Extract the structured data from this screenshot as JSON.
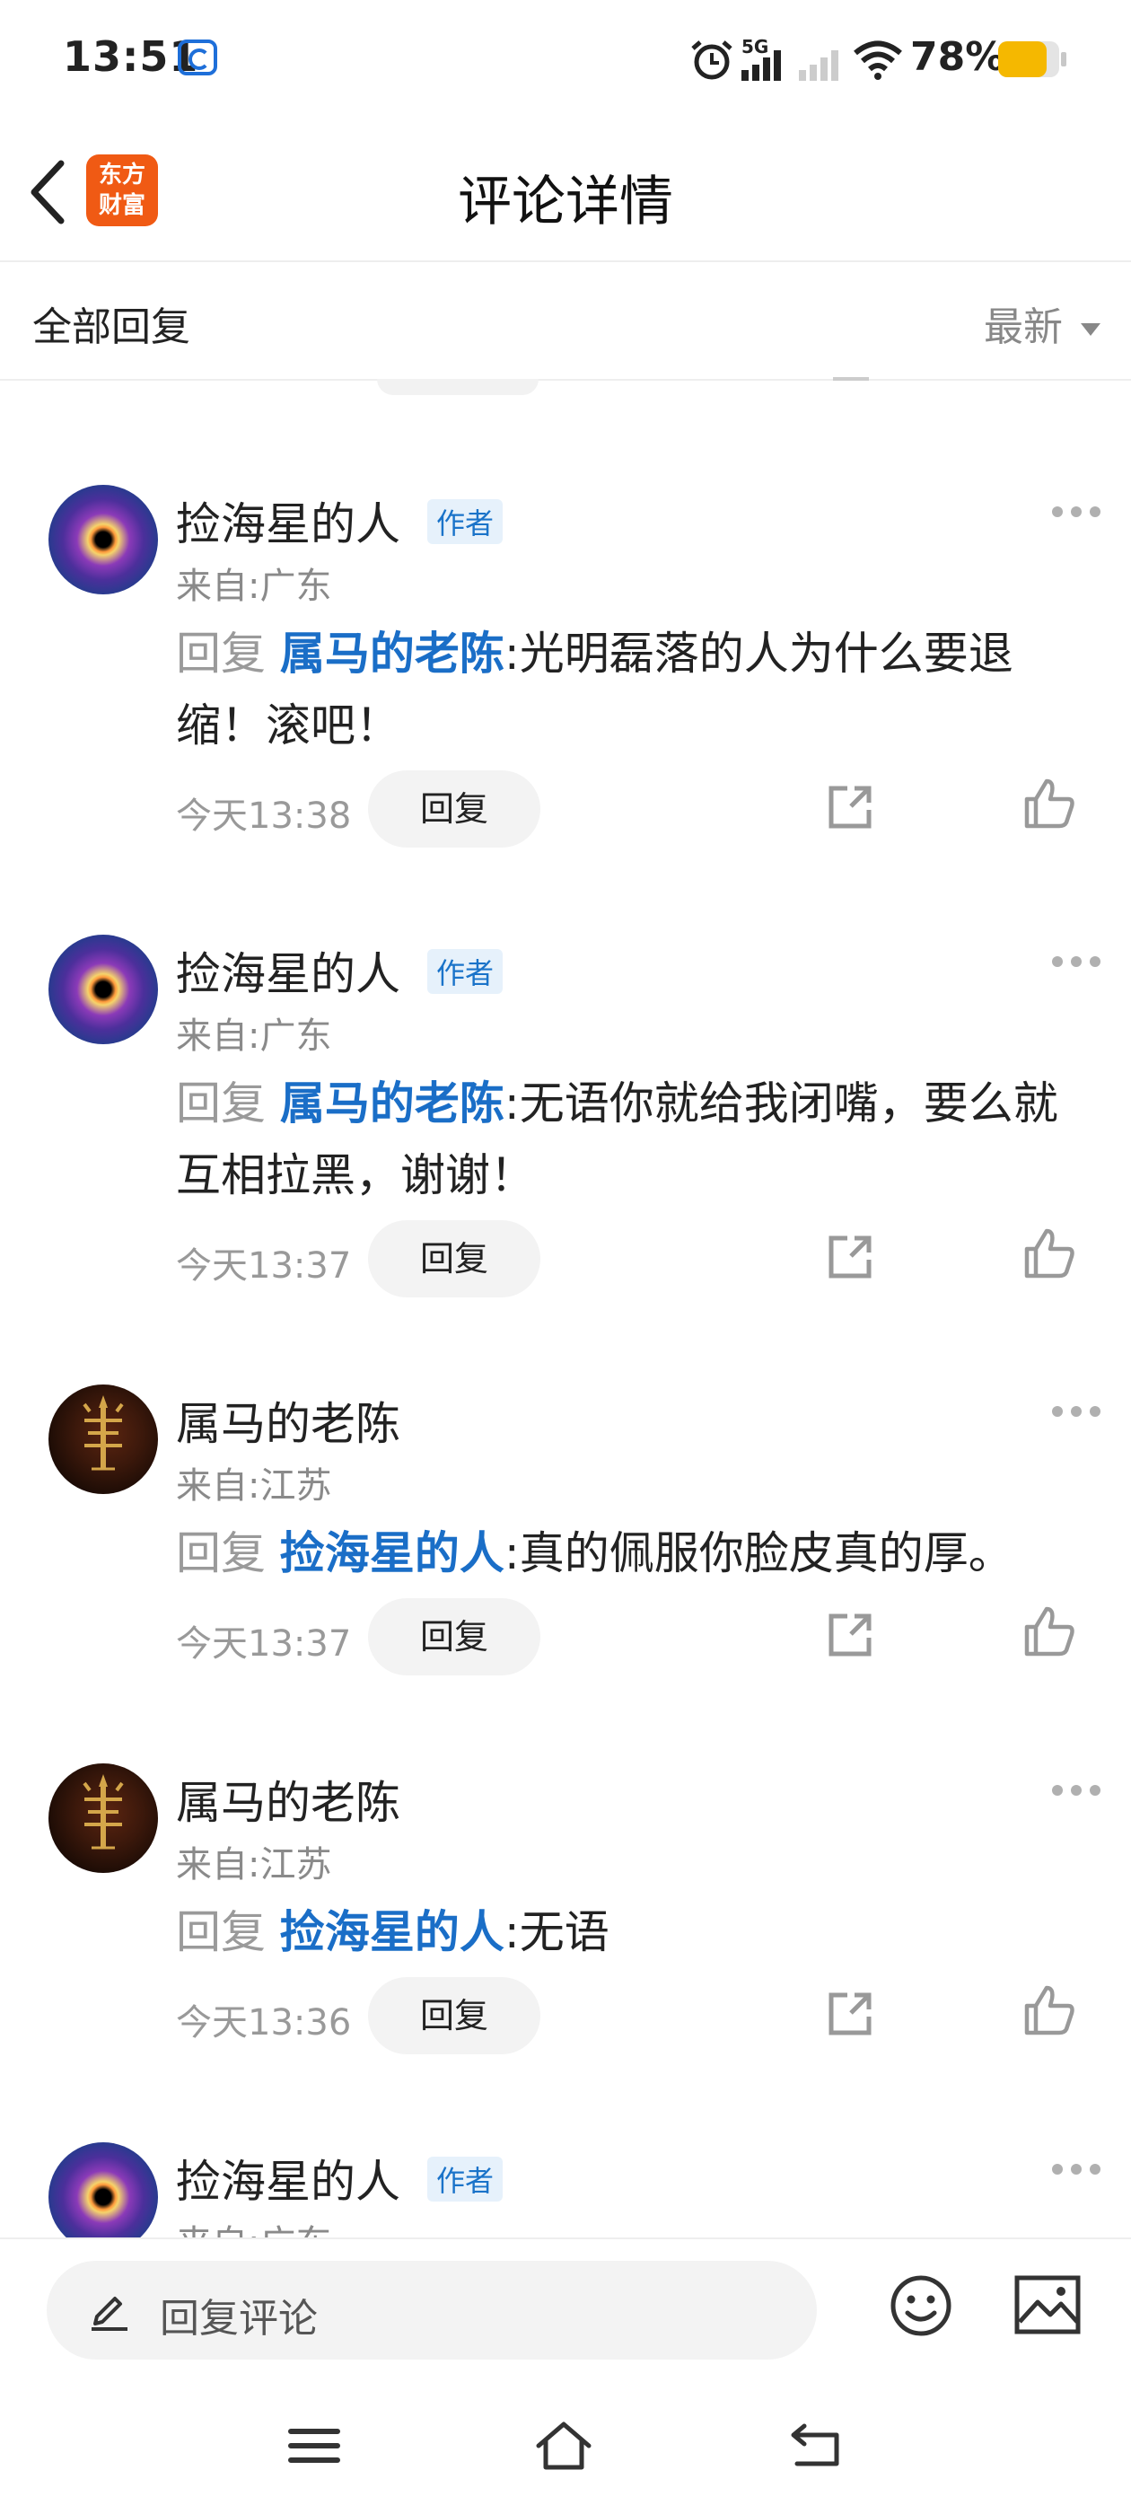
{
  "status_bar": {
    "time": "13:51",
    "network": "5G",
    "battery": "78%",
    "battery_color": "#f5b800"
  },
  "header": {
    "title": "评论详情",
    "logo_line1": "东方",
    "logo_line2": "财富",
    "logo_color": "#f05a14"
  },
  "sort_bar": {
    "label": "全部回复",
    "sort": "最新"
  },
  "colors": {
    "accent": "#1a6ec7",
    "badge_bg": "#e6f1fb"
  },
  "comments": [
    {
      "name": "捡海星的人",
      "badge": "作者",
      "location": "来自:广东",
      "reply_prefix": "回复",
      "target": "属马的老陈",
      "text": ":光明磊落的人为什么要退缩！滚吧！",
      "time": "今天13:38",
      "reply_label": "回复",
      "avatar": "galaxy"
    },
    {
      "name": "捡海星的人",
      "badge": "作者",
      "location": "来自:广东",
      "reply_prefix": "回复",
      "target": "属马的老陈",
      "text": ":无语你就给我闭嘴，要么就互相拉黑，谢谢！",
      "time": "今天13:37",
      "reply_label": "回复",
      "avatar": "galaxy"
    },
    {
      "name": "属马的老陈",
      "badge": "",
      "location": "来自:江苏",
      "reply_prefix": "回复",
      "target": "捡海星的人",
      "text": ":真的佩服你脸皮真的厚。",
      "time": "今天13:37",
      "reply_label": "回复",
      "avatar": "gold"
    },
    {
      "name": "属马的老陈",
      "badge": "",
      "location": "来自:江苏",
      "reply_prefix": "回复",
      "target": "捡海星的人",
      "text": ":无语",
      "time": "今天13:36",
      "reply_label": "回复",
      "avatar": "gold"
    },
    {
      "name": "捡海星的人",
      "badge": "作者",
      "location": "来自:广东",
      "avatar": "galaxy"
    }
  ],
  "input_bar": {
    "placeholder": "回复评论"
  },
  "icons": [
    "back-icon",
    "more-icon",
    "share-icon",
    "like-icon",
    "pen-icon",
    "emoji-icon",
    "image-icon",
    "menu-icon",
    "home-icon",
    "return-icon"
  ]
}
